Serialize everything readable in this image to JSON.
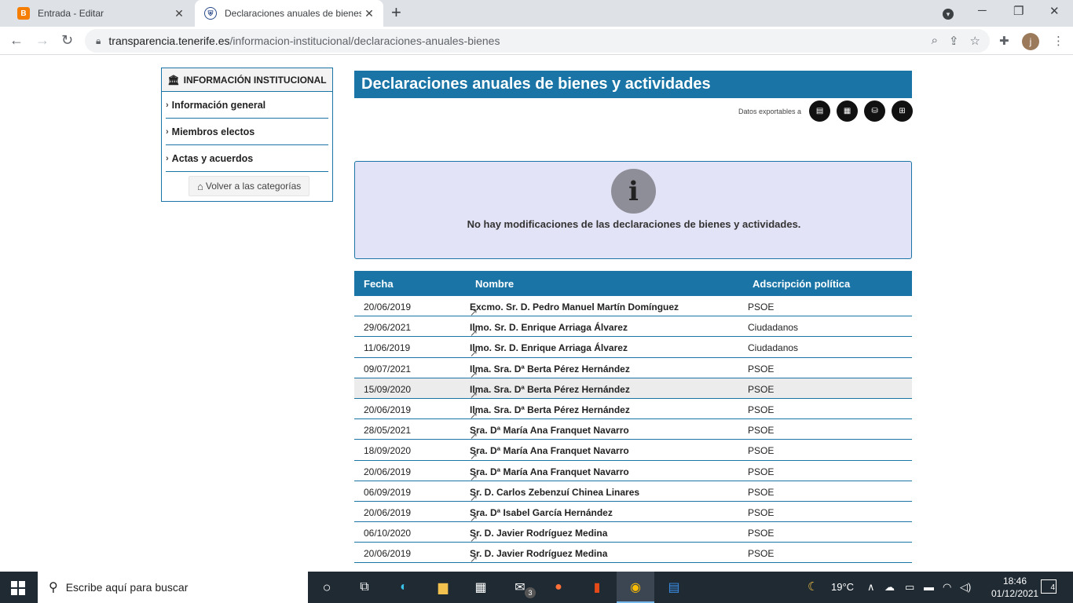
{
  "browser": {
    "tabs": [
      {
        "title": "Entrada - Editar",
        "favicon": "blogger-icon"
      },
      {
        "title": "Declaraciones anuales de bienes",
        "favicon": "cabildo-icon"
      }
    ],
    "url_host": "transparencia.tenerife.es",
    "url_path": "/informacion-institucional/declaraciones-anuales-bienes",
    "profile_initial": "j"
  },
  "sidebar": {
    "heading": "INFORMACIÓN INSTITUCIONAL",
    "items": [
      {
        "label": "Información general"
      },
      {
        "label": "Miembros electos"
      },
      {
        "label": "Actas y acuerdos"
      }
    ],
    "back_label": "Volver a las categorías"
  },
  "main": {
    "title": "Declaraciones anuales de bienes y actividades",
    "export_label": "Datos exportables a",
    "notice": "No hay modificaciones de las declaraciones de bienes y actividades.",
    "table": {
      "headers": [
        "Fecha",
        "Nombre",
        "Adscripción política"
      ],
      "rows": [
        {
          "fecha": "20/06/2019",
          "nombre": "Excmo. Sr. D. Pedro Manuel Martín Domínguez",
          "partido": "PSOE"
        },
        {
          "fecha": "29/06/2021",
          "nombre": "Ilmo. Sr. D. Enrique Arriaga Álvarez",
          "partido": "Ciudadanos"
        },
        {
          "fecha": "11/06/2019",
          "nombre": "Ilmo. Sr. D. Enrique Arriaga Álvarez",
          "partido": "Ciudadanos"
        },
        {
          "fecha": "09/07/2021",
          "nombre": "Ilma. Sra. Dª Berta Pérez Hernández",
          "partido": "PSOE"
        },
        {
          "fecha": "15/09/2020",
          "nombre": "Ilma. Sra. Dª Berta Pérez Hernández",
          "partido": "PSOE"
        },
        {
          "fecha": "20/06/2019",
          "nombre": "Ilma. Sra. Dª Berta Pérez Hernández",
          "partido": "PSOE"
        },
        {
          "fecha": "28/05/2021",
          "nombre": "Sra. Dª María Ana Franquet Navarro",
          "partido": "PSOE"
        },
        {
          "fecha": "18/09/2020",
          "nombre": "Sra. Dª María Ana Franquet Navarro",
          "partido": "PSOE"
        },
        {
          "fecha": "20/06/2019",
          "nombre": "Sra. Dª María Ana Franquet Navarro",
          "partido": "PSOE"
        },
        {
          "fecha": "06/09/2019",
          "nombre": "Sr. D. Carlos Zebenzuí Chinea Linares",
          "partido": "PSOE"
        },
        {
          "fecha": "20/06/2019",
          "nombre": "Sra. Dª Isabel García Hernández",
          "partido": "PSOE"
        },
        {
          "fecha": "06/10/2020",
          "nombre": "Sr. D. Javier Rodríguez Medina",
          "partido": "PSOE"
        },
        {
          "fecha": "20/06/2019",
          "nombre": "Sr. D. Javier Rodríguez Medina",
          "partido": "PSOE"
        },
        {
          "fecha": "",
          "nombre": "",
          "partido": ""
        }
      ],
      "highlighted_row": 4
    }
  },
  "taskbar": {
    "search_placeholder": "Escribe aquí para buscar",
    "mail_badge": "3",
    "weather": "19°C",
    "time": "18:46",
    "date": "01/12/2021",
    "notification_count": "4"
  },
  "colors": {
    "accent": "#1a75a6",
    "notice_bg": "#e3e3f7",
    "taskbar": "#1f2a33"
  }
}
